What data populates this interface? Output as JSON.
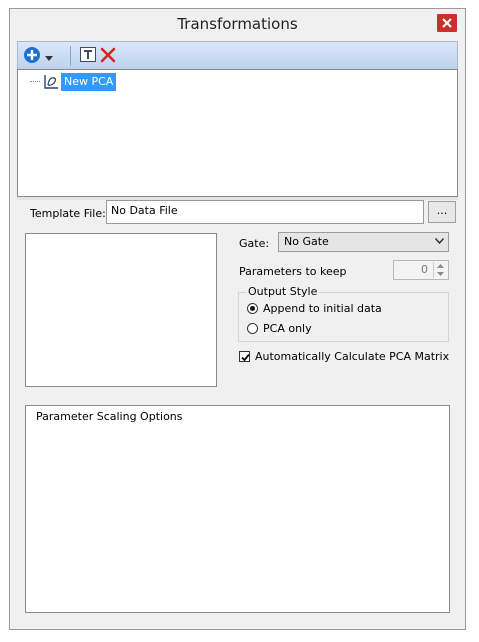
{
  "window": {
    "title": "Transformations"
  },
  "toolbar": {
    "items": [
      {
        "icon": "add-icon"
      },
      {
        "icon": "chevron-down-icon"
      },
      {
        "icon": "template-icon"
      },
      {
        "icon": "delete-icon"
      }
    ]
  },
  "tree": {
    "items": [
      {
        "label": "New PCA",
        "icon": "pca-icon",
        "selected": true
      }
    ]
  },
  "template_file": {
    "label": "Template File:",
    "value": "No Data File",
    "browse_label": "..."
  },
  "gate": {
    "label": "Gate:",
    "value": "No Gate"
  },
  "parameters": {
    "label": "Parameters to keep",
    "value": "0"
  },
  "output_style": {
    "legend": "Output Style",
    "options": [
      {
        "label": "Append to initial data",
        "selected": true
      },
      {
        "label": "PCA only",
        "selected": false
      }
    ]
  },
  "auto_calc": {
    "label": "Automatically Calculate PCA Matrix",
    "checked": true
  },
  "scaling": {
    "title": "Parameter Scaling Options"
  },
  "colors": {
    "selection": "#3399ff",
    "close": "#c9302c",
    "toolbar": "#c8daf1"
  }
}
